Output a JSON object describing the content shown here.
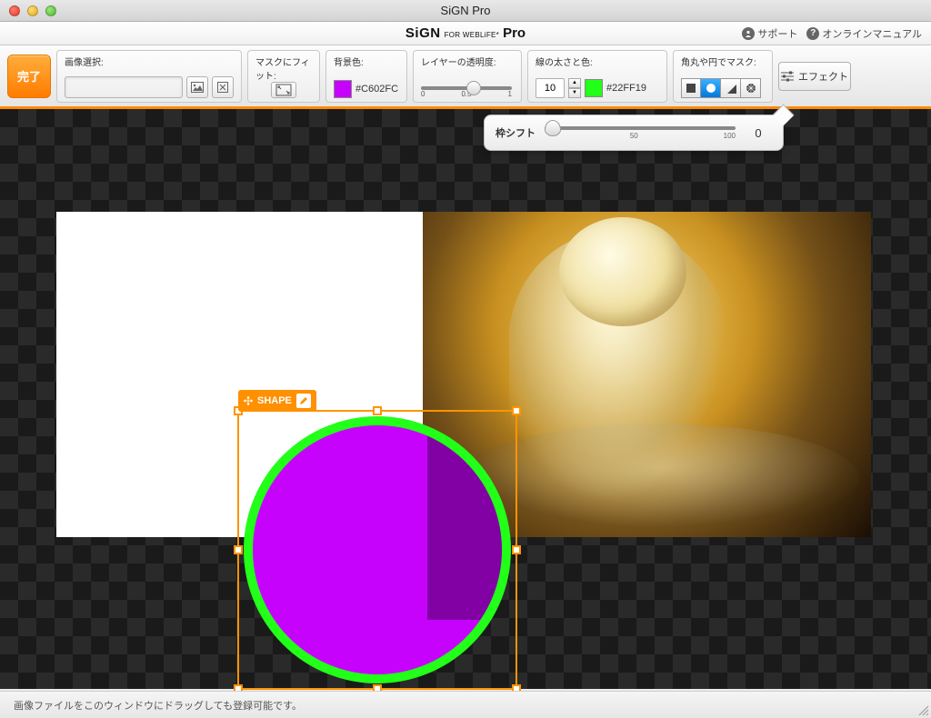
{
  "titlebar": {
    "title": "SiGN Pro"
  },
  "brand": {
    "main": "SiGN",
    "sub": "FOR WEBLiFE*",
    "pro": "Pro"
  },
  "header_links": {
    "support": "サポート",
    "manual": "オンラインマニュアル"
  },
  "toolbar": {
    "done": "完了",
    "image_select_label": "画像選択:",
    "fit_label": "マスクにフィット:",
    "bg_label": "背景色:",
    "bg_hex": "#C602FC",
    "opacity_label": "レイヤーの透明度:",
    "opacity_ticks": {
      "min": "0",
      "mid": "0.5",
      "max": "1"
    },
    "border_label": "線の太さと色:",
    "border_width": "10",
    "border_hex": "#22FF19",
    "mask_label": "角丸や円でマスク:",
    "effect": "エフェクト"
  },
  "shift_popup": {
    "label": "枠シフト",
    "tick_mid": "50",
    "tick_max": "100",
    "value": "0"
  },
  "shape_badge": {
    "label": "SHAPE"
  },
  "statusbar": {
    "hint": "画像ファイルをこのウィンドウにドラッグしても登録可能です。"
  },
  "colors": {
    "bg_swatch": "#C602FC",
    "border_swatch": "#22FF19"
  }
}
